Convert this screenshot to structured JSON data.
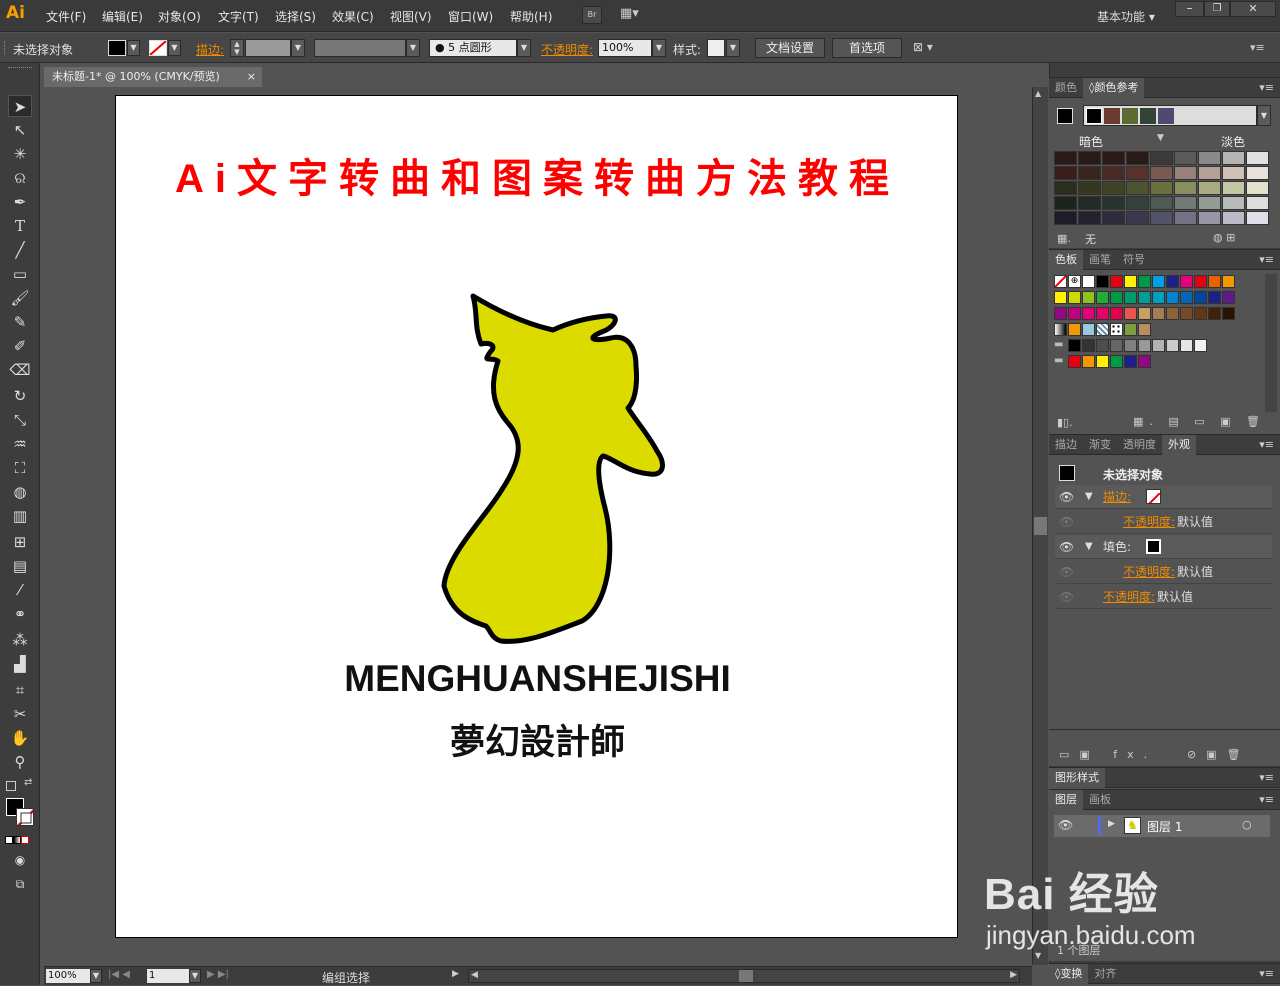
{
  "app_logo": "Ai",
  "menus": [
    "文件(F)",
    "编辑(E)",
    "对象(O)",
    "文字(T)",
    "选择(S)",
    "效果(C)",
    "视图(V)",
    "窗口(W)",
    "帮助(H)"
  ],
  "bridge_label": "Br",
  "workspace": "基本功能",
  "control": {
    "selection": "未选择对象",
    "stroke_label": "描边:",
    "brush_label": "5 点圆形",
    "opacity_label": "不透明度:",
    "opacity_value": "100%",
    "style_label": "样式:",
    "doc_setup": "文档设置",
    "prefs": "首选项"
  },
  "document": {
    "tab_title": "未标题-1* @ 100% (CMYK/预览)",
    "heading": "Ai文字转曲和图案转曲方法教程",
    "latin_text": "MENGHUANSHEJISHI",
    "cjk_text": "夢幻設計師",
    "heading_color": "#ff0000",
    "shape_fill": "#dbdb00"
  },
  "status": {
    "zoom": "100%",
    "artboard_num": "1",
    "mode": "编组选择"
  },
  "color_panel": {
    "tabs": [
      "颜色",
      "颜色参考"
    ],
    "dark_label": "暗色",
    "light_label": "淡色",
    "none_label": "无"
  },
  "swatch_panel": {
    "tabs": [
      "色板",
      "画笔",
      "符号"
    ]
  },
  "appearance_panel": {
    "tabs": [
      "描边",
      "渐变",
      "透明度",
      "外观"
    ],
    "title": "未选择对象",
    "stroke_label": "描边:",
    "fill_label": "填色:",
    "opacity_label": "不透明度:",
    "default_value": "默认值"
  },
  "graphic_styles": {
    "tab": "图形样式"
  },
  "layers_panel": {
    "tabs": [
      "图层",
      "画板"
    ],
    "layer_name": "图层 1",
    "layer_count": "1 个图层"
  },
  "bottom_panel": {
    "tabs": [
      "变换",
      "对齐"
    ]
  },
  "watermark": {
    "brand": "Bai 经验",
    "url": "jingyan.baidu.com"
  }
}
